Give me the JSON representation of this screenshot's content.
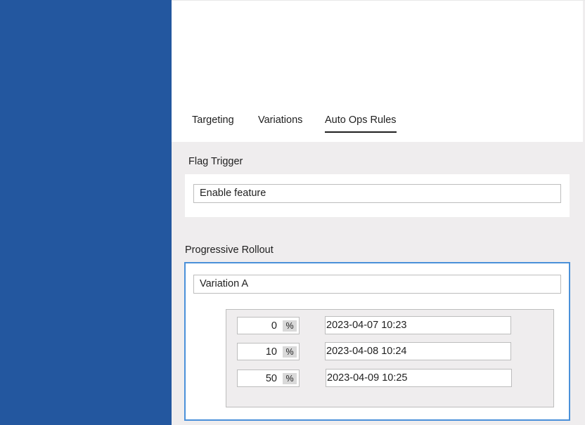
{
  "tabs": [
    {
      "label": "Targeting"
    },
    {
      "label": "Variations"
    },
    {
      "label": "Auto Ops Rules",
      "active": true
    }
  ],
  "flag_trigger": {
    "title": "Flag Trigger",
    "value": "Enable feature"
  },
  "progressive_rollout": {
    "title": "Progressive Rollout",
    "variation": "Variation A",
    "steps": [
      {
        "percent": "0",
        "unit": "%",
        "datetime": "2023-04-07 10:23"
      },
      {
        "percent": "10",
        "unit": "%",
        "datetime": "2023-04-08 10:24"
      },
      {
        "percent": "50",
        "unit": "%",
        "datetime": "2023-04-09 10:25"
      }
    ]
  },
  "colors": {
    "sidebar": "#23579f",
    "content_background": "#efedee",
    "active_card_border": "#4a90d9"
  }
}
